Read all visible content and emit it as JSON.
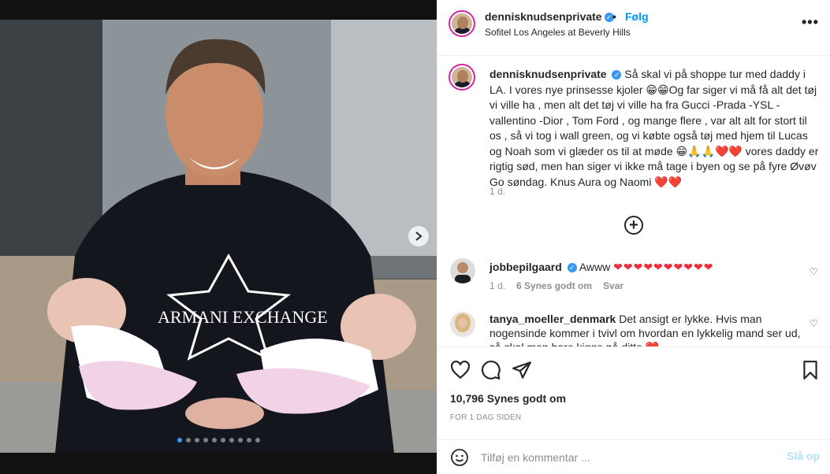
{
  "header": {
    "username": "dennisknudsenprivate",
    "separator": "•",
    "follow_label": "Følg",
    "location": "Sofitel Los Angeles at Beverly Hills",
    "more_label": "•••"
  },
  "media": {
    "dots_count": 10,
    "active_dot": 0,
    "next_icon": "chevron-right-icon"
  },
  "caption": {
    "username": "dennisknudsenprivate",
    "text": "Så skal vi på shoppe tur med daddy i LA. I vores nye prinsesse kjoler 😁😁Og far siger vi må få alt det tøj vi ville ha , men alt det tøj vi ville ha fra Gucci -Prada -YSL - vallentino -Dior , Tom Ford , og mange flere , var alt alt for stort til os , så vi tog i wall green, og vi købte også tøj med hjem til Lucas og Noah som vi glæder os til at møde 😁🙏🙏❤️❤️ vores daddy er rigtig sød, men han siger vi ikke må tage i byen og se på fyre Øvøv Go søndag. Knus Aura og Naomi ❤️❤️",
    "time": "1 d."
  },
  "load_more_label": "+",
  "comments": [
    {
      "username": "jobbepilgaard",
      "text": "Awww",
      "hearts": "❤❤❤❤❤❤❤❤❤❤",
      "time": "1 d.",
      "likes": "6 Synes godt om",
      "reply": "Svar"
    },
    {
      "username": "tanya_moeller_denmark",
      "text": "Det ansigt er lykke. Hvis man nogensinde kommer i tvivl om hvordan en lykkelig mand ser ud, så skal man bare kigge på ditte ❤️"
    }
  ],
  "actions": {
    "likes": "10,796 Synes godt om",
    "time_ago": "FOR 1 DAG SIDEN"
  },
  "add_comment": {
    "placeholder": "Tilføj en kommentar ...",
    "post_label": "Slå op"
  },
  "colors": {
    "accent": "#0095f6",
    "heart": "#ed2e3a",
    "muted": "#8e8e8e"
  }
}
